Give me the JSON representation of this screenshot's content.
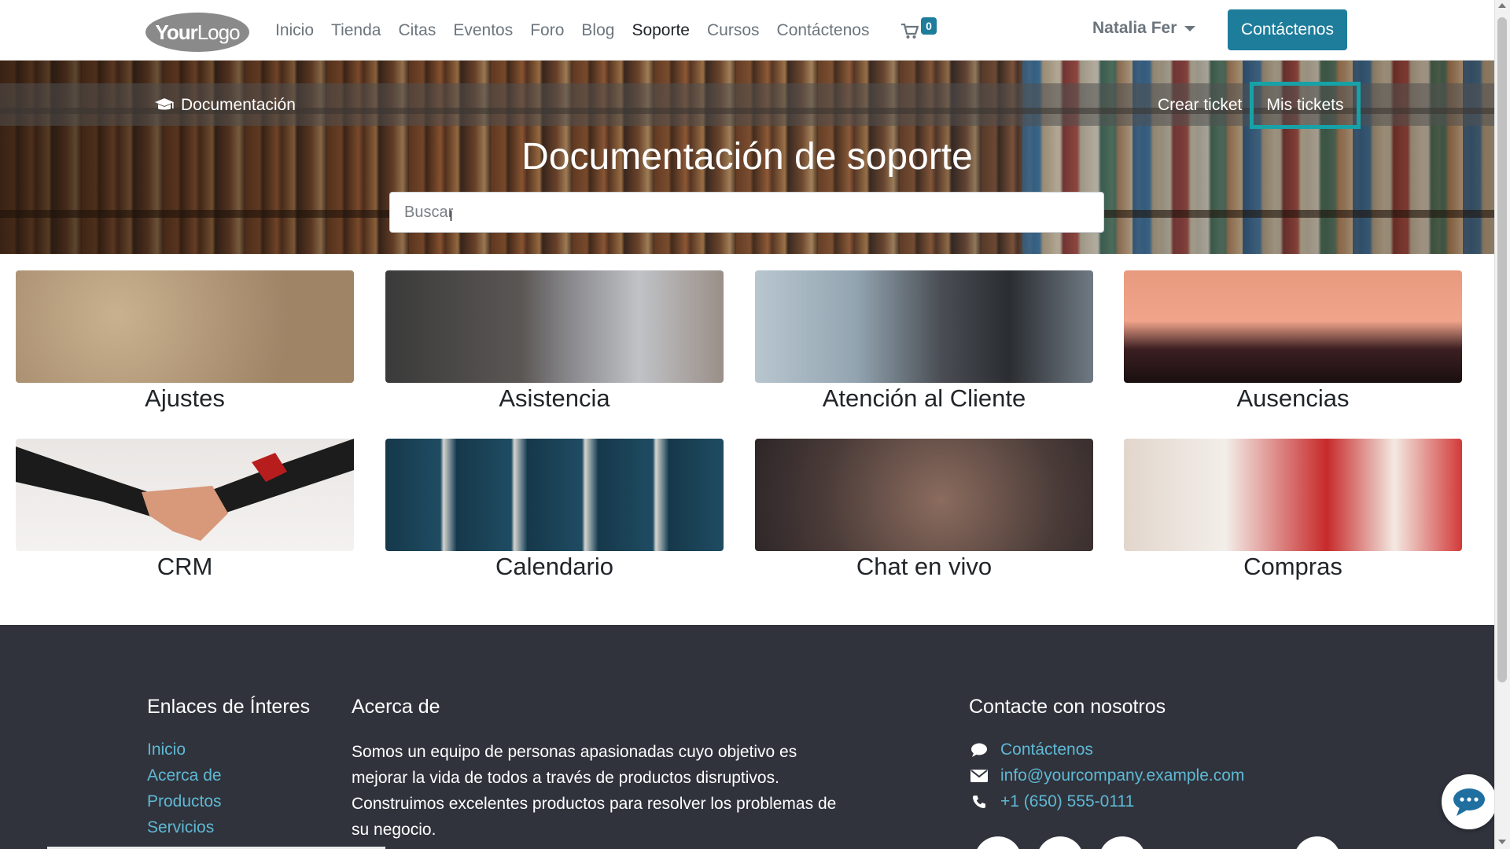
{
  "header": {
    "logo_bold": "Your",
    "logo_light": "Logo",
    "menu": [
      {
        "label": "Inicio",
        "active": false
      },
      {
        "label": "Tienda",
        "active": false
      },
      {
        "label": "Citas",
        "active": false
      },
      {
        "label": "Eventos",
        "active": false
      },
      {
        "label": "Foro",
        "active": false
      },
      {
        "label": "Blog",
        "active": false
      },
      {
        "label": "Soporte",
        "active": true
      },
      {
        "label": "Cursos",
        "active": false
      },
      {
        "label": "Contáctenos",
        "active": false
      }
    ],
    "cart_count": "0",
    "user_name": "Natalia Fer",
    "contact_button": "Contáctenos",
    "accent_color": "#1e7d9b"
  },
  "hero": {
    "doc_link": "Documentación",
    "crear_ticket": "Crear ticket",
    "mis_tickets": "Mis tickets",
    "title": "Documentación de soporte",
    "search_placeholder": "Buscar",
    "search_value": ""
  },
  "categories": [
    {
      "label": "Ajustes"
    },
    {
      "label": "Asistencia"
    },
    {
      "label": "Atención al Cliente"
    },
    {
      "label": "Ausencias"
    },
    {
      "label": "CRM"
    },
    {
      "label": "Calendario"
    },
    {
      "label": "Chat en vivo"
    },
    {
      "label": "Compras"
    }
  ],
  "footer": {
    "links_title": "Enlaces de Ínteres",
    "links": [
      "Inicio",
      "Acerca de",
      "Productos",
      "Servicios"
    ],
    "about_title": "Acerca de",
    "about_text": "Somos un equipo de personas apasionadas cuyo objetivo es mejorar la vida de todos a través de productos disruptivos. Construimos excelentes productos para resolver los problemas de su negocio.",
    "contact_title": "Contacte con nosotros",
    "contact_items": [
      {
        "icon": "comment-icon",
        "label": "Contáctenos"
      },
      {
        "icon": "envelope-icon",
        "label": "info@yourcompany.example.com"
      },
      {
        "icon": "phone-icon",
        "label": "+1 (650) 555-0111"
      }
    ]
  }
}
